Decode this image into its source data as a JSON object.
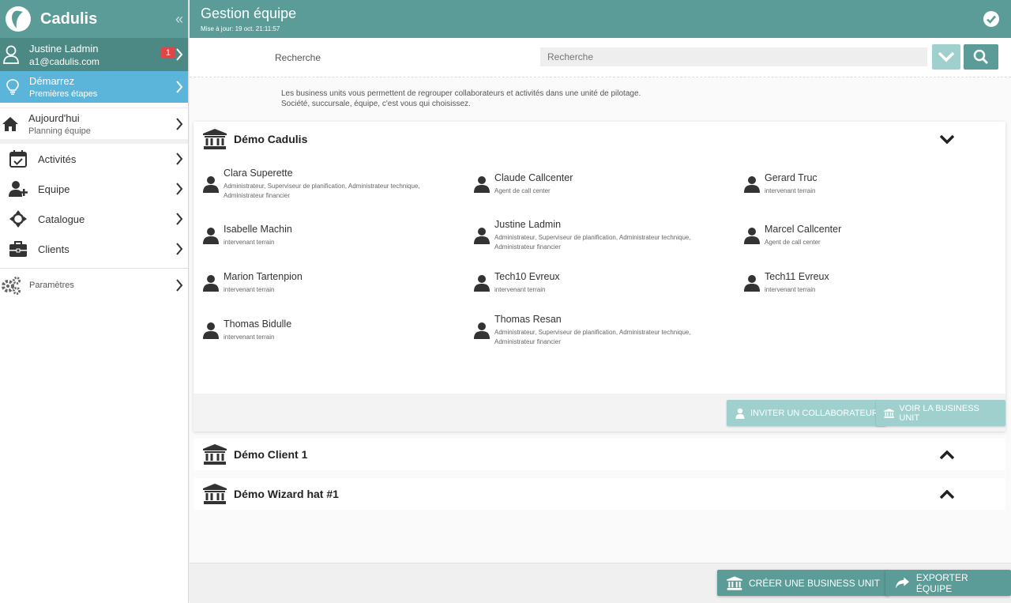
{
  "brand": {
    "name": "Cadulis"
  },
  "user": {
    "name": "Justine Ladmin",
    "email": "a1@cadulis.com",
    "badge": "1"
  },
  "start": {
    "title": "Démarrez",
    "subtitle": "Premières étapes"
  },
  "today": {
    "title": "Aujourd'hui",
    "subtitle": "Planning équipe"
  },
  "nav": [
    {
      "label": "Activités"
    },
    {
      "label": "Equipe"
    },
    {
      "label": "Catalogue"
    },
    {
      "label": "Clients"
    }
  ],
  "params": {
    "label": "Paramètres"
  },
  "header": {
    "title": "Gestion équipe",
    "updated": "Mise à jour: 19 oct. 21:11:57"
  },
  "search": {
    "label": "Recherche",
    "placeholder": "Recherche"
  },
  "intro": {
    "line1": "Les business units vous permettent de regrouper collaborateurs et activités dans une unité de pilotage.",
    "line2": "Société, succursale, équipe, c'est vous qui choisissez."
  },
  "business_units": [
    {
      "name": "Démo Cadulis",
      "members": [
        {
          "name": "Clara Superette",
          "role1": "Administrateur, Superviseur de planification, Administrateur technique,",
          "role2": "Administrateur financier"
        },
        {
          "name": "Claude Callcenter",
          "role1": "Agent de call center",
          "role2": ""
        },
        {
          "name": "Gerard Truc",
          "role1": "intervenant terrain",
          "role2": ""
        },
        {
          "name": "Isabelle Machin",
          "role1": "intervenant terrain",
          "role2": ""
        },
        {
          "name": "Justine Ladmin",
          "role1": "Administrateur, Superviseur de planification, Administrateur technique,",
          "role2": "Administrateur financier"
        },
        {
          "name": "Marcel Callcenter",
          "role1": "Agent de call center",
          "role2": ""
        },
        {
          "name": "Marion Tartenpion",
          "role1": "intervenant terrain",
          "role2": ""
        },
        {
          "name": "Tech10 Evreux",
          "role1": "intervenant terrain",
          "role2": ""
        },
        {
          "name": "Tech11 Evreux",
          "role1": "intervenant terrain",
          "role2": ""
        },
        {
          "name": "Thomas Bidulle",
          "role1": "intervenant terrain",
          "role2": ""
        },
        {
          "name": "Thomas Resan",
          "role1": "Administrateur, Superviseur de planification, Administrateur technique,",
          "role2": "Administrateur financier"
        }
      ],
      "invite_label": "INVITER UN COLLABORATEUR",
      "view_label": "VOIR LA BUSINESS UNIT"
    },
    {
      "name": "Démo Client 1"
    },
    {
      "name": "Démo Wizard hat #1"
    }
  ],
  "footer": {
    "create_label": "CRÉER UNE BUSINESS UNIT",
    "export_label": "EXPORTER ÉQUIPE"
  },
  "colors": {
    "primary": "#5b9c98",
    "primary_dark": "#4c8884",
    "light_teal": "#9fd0cd",
    "start_blue": "#5bb5db",
    "badge_red": "#e04646"
  }
}
